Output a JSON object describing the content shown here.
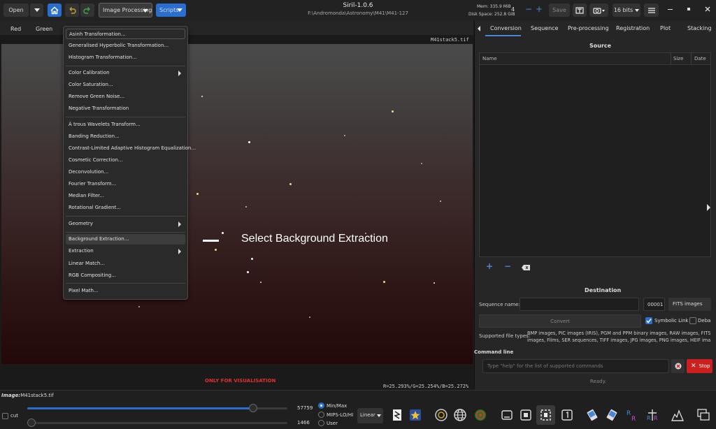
{
  "header": {
    "title": "Siril-1.0.6",
    "path": "F:\\Andromonda\\Astronomy\\M41\\M41-127",
    "open_label": "Open",
    "image_processing_label": "Image Processing",
    "scripts_label": "Scripts",
    "mem_label": "Mem: 335.9 MiB",
    "disk_label": "Disk Space: 252.8 GiB",
    "threads": "4",
    "save_label": "Save",
    "bits_label": "16 bits"
  },
  "channels": [
    "Red",
    "Green"
  ],
  "image": {
    "filename": "M41stack5.tif",
    "overlay_text": "Select Background Extraction",
    "visualisation_note": "ONLY FOR VISUALISATION",
    "rgb_readout": "R=25.293%/G=25.254%/B=25.272%",
    "image_label": "Image:",
    "image_value": "M41stack5.tif"
  },
  "menu": {
    "items": [
      "Asinh Transformation...",
      "Generalised Hyperbolic Transformation...",
      "Histogram Transformation...",
      "Color Calibration",
      "Color Saturation...",
      "Remove Green Noise...",
      "Negative Transformation",
      "À trous Wavelets Transform...",
      "Banding Reduction...",
      "Contrast-Limited Adaptive Histogram Equalization...",
      "Cosmetic Correction...",
      "Deconvolution...",
      "Fourier Transform...",
      "Median Filter...",
      "Rotational Gradient...",
      "Geometry",
      "Background Extraction...",
      "Extraction",
      "Linear Match...",
      "RGB Compositing...",
      "Pixel Math..."
    ]
  },
  "right_tabs": [
    "Conversion",
    "Sequence",
    "Pre-processing",
    "Registration",
    "Plot",
    "Stacking"
  ],
  "conversion": {
    "source_label": "Source",
    "col_name": "Name",
    "col_size": "Size",
    "col_date": "Date",
    "destination_label": "Destination",
    "sequence_name_label": "Sequence name:",
    "sequence_number": "00001",
    "format_label": "FITS images",
    "convert_label": "Convert",
    "symbolic_link_label": "Symbolic Link",
    "debayer_label": "Deba",
    "supported_label": "Supported file types:",
    "supported_text_1": "BMP images, PIC images (IRIS), PGM and PPM binary images, RAW images, FITS-C",
    "supported_text_2": "images, Films, SER sequences, TIFF images, JPG images, PNG images, HEIF images"
  },
  "command": {
    "label": "Command line",
    "placeholder": "Type \"help\" for the list of supported commands",
    "stop_label": "Stop",
    "status": "Ready."
  },
  "bottom": {
    "cut_label": "cut",
    "high_value": "57759",
    "low_value": "1466",
    "radio_minmax": "Min/Max",
    "radio_mips": "MIPS-LO/HI",
    "radio_user": "User",
    "scale_label": "Linear",
    "high_slider_fraction": 0.88,
    "low_slider_fraction": 0.0
  },
  "colors": {
    "accent_blue": "#2a6fd0",
    "stop_red": "#cc1f1f",
    "note_red": "#e23030"
  }
}
